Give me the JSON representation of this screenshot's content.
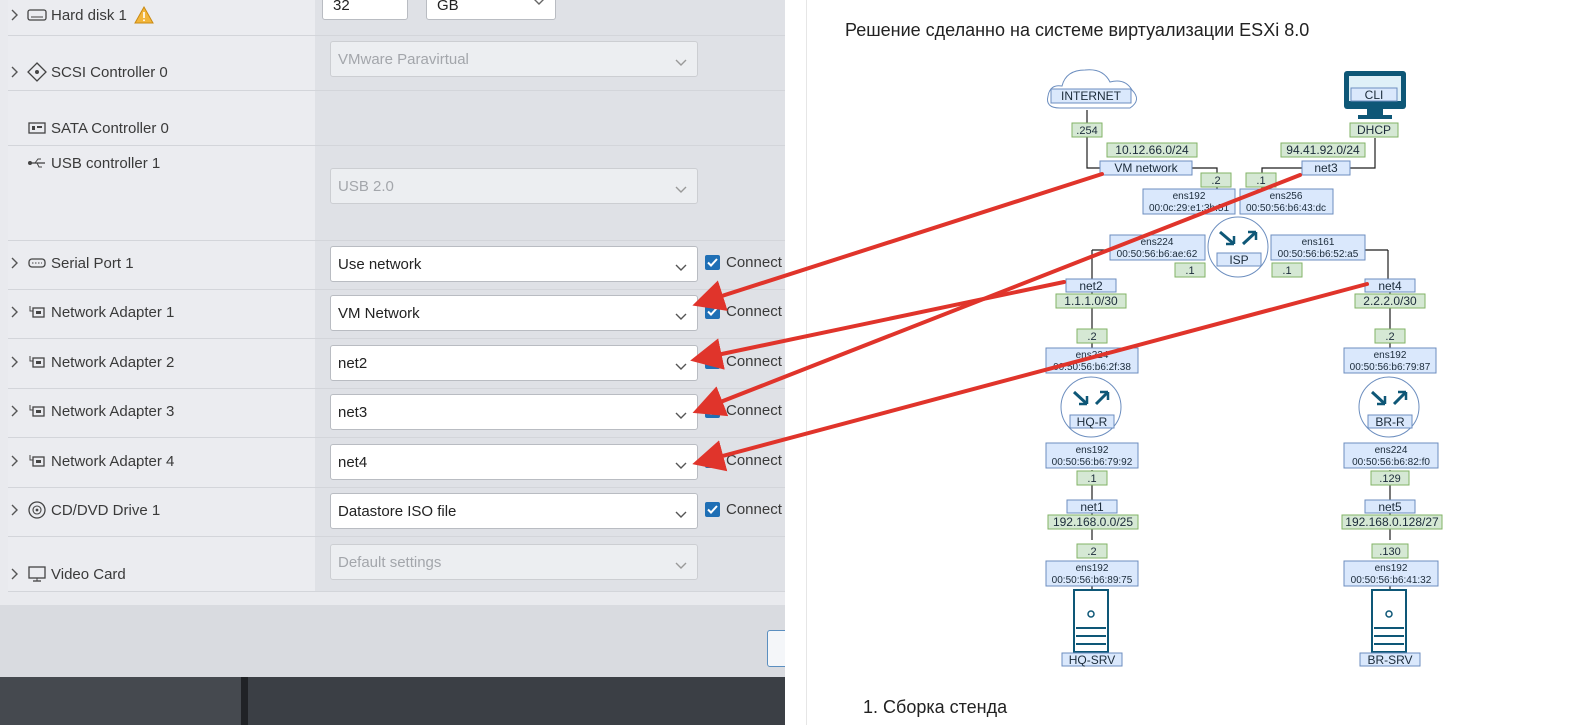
{
  "vm_settings": {
    "hard_disk": {
      "label": "Hard disk 1",
      "size": "32",
      "unit": "GB"
    },
    "scsi": {
      "label": "SCSI Controller 0",
      "value": "VMware Paravirtual"
    },
    "sata": {
      "label": "SATA Controller 0"
    },
    "usb": {
      "label": "USB controller 1",
      "value": "USB 2.0"
    },
    "serial": {
      "label": "Serial Port 1",
      "value": "Use network",
      "connect": "Connect"
    },
    "adapters": [
      {
        "label": "Network Adapter 1",
        "value": "VM Network",
        "connect": "Connect"
      },
      {
        "label": "Network Adapter 2",
        "value": "net2",
        "connect": "Connect"
      },
      {
        "label": "Network Adapter 3",
        "value": "net3",
        "connect": "Connect"
      },
      {
        "label": "Network Adapter 4",
        "value": "net4",
        "connect": "Connect"
      }
    ],
    "cddvd": {
      "label": "CD/DVD Drive 1",
      "value": "Datastore ISO file",
      "connect": "Connect"
    },
    "video": {
      "label": "Video Card",
      "value": "Default settings"
    }
  },
  "doc": {
    "heading": "Решение сделанно на системе виртуализации ESXi 8.0",
    "list_item": "1. Сборка стенда"
  },
  "diagram": {
    "internet": "INTERNET",
    "internet_ip": ".254",
    "cli": "CLI",
    "dhcp": "DHCP",
    "subnet_vm": "10.12.66.0/24",
    "subnet_net3": "94.41.92.0/24",
    "vm_network": "VM network",
    "net3": "net3",
    "isp_left_ip": ".2",
    "isp_right_ip": ".1",
    "isp_ens192_name": "ens192",
    "isp_ens192_mac": "00:0c:29:e1:3b:51",
    "isp_ens256_name": "ens256",
    "isp_ens256_mac": "00:50:56:b6:43:dc",
    "isp_ens224_name": "ens224",
    "isp_ens224_mac": "00:50:56:b6:ae:62",
    "isp_ens161_name": "ens161",
    "isp_ens161_mac": "00:50:56:b6:52:a5",
    "isp": "ISP",
    "isp_net2_ip": ".1",
    "isp_net4_ip": ".1",
    "net2": "net2",
    "net4": "net4",
    "subnet_net2": "1.1.1.0/30",
    "subnet_net4": "2.2.2.0/30",
    "hqr_wan_ip": ".2",
    "brr_wan_ip": ".2",
    "hqr_ens224_name": "ens224",
    "hqr_ens224_mac": "00:50:56:b6:2f:38",
    "brr_ens192_name": "ens192",
    "brr_ens192_mac": "00:50:56:b6:79:87",
    "hqr": "HQ-R",
    "brr": "BR-R",
    "hqr_ens192_name": "ens192",
    "hqr_ens192_mac": "00:50:56:b6:79:92",
    "brr_ens224_name": "ens224",
    "brr_ens224_mac": "00:50:56:b6:82:f0",
    "hqr_lan_ip": ".1",
    "brr_lan_ip": ".129",
    "net1": "net1",
    "net5": "net5",
    "subnet_net1": "192.168.0.0/25",
    "subnet_net5": "192.168.0.128/27",
    "hqsrv_ip": ".2",
    "brsrv_ip": ".130",
    "hqsrv_ens_name": "ens192",
    "hqsrv_ens_mac": "00:50:56:b6:89:75",
    "brsrv_ens_name": "ens192",
    "brsrv_ens_mac": "00:50:56:b6:41:32",
    "hqsrv": "HQ-SRV",
    "brsrv": "BR-SRV"
  },
  "colors": {
    "arrow": "#e0342b",
    "checkbox": "#1f6fb5",
    "node_fill": "#dae8fc",
    "ip_fill": "#d5e8d4",
    "router_icon": "#0e5777"
  }
}
